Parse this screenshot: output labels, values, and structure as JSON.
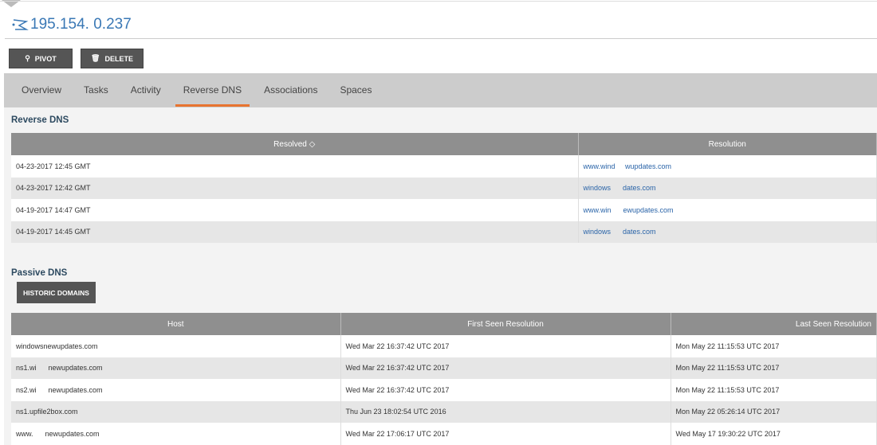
{
  "header": {
    "title": "195.154.  0.237",
    "pivot": "PIVOT",
    "delete": "DELETE"
  },
  "tabs": [
    "Overview",
    "Tasks",
    "Activity",
    "Reverse DNS",
    "Associations",
    "Spaces"
  ],
  "reverse_dns": {
    "title": "Reverse DNS",
    "columns": [
      "Resolved ◇",
      "Resolution"
    ],
    "rows": [
      [
        "04-23-2017 12:45 GMT",
        "www.wind     wupdates.com"
      ],
      [
        "04-23-2017 12:42 GMT",
        "windows      dates.com"
      ],
      [
        "04-19-2017 14:47 GMT",
        "www.win      ewupdates.com"
      ],
      [
        "04-19-2017 14:45 GMT",
        "windows      dates.com"
      ]
    ]
  },
  "passive_dns": {
    "title": "Passive DNS",
    "historic_button": "HISTORIC DOMAINS",
    "columns": [
      "Host",
      "First Seen Resolution",
      "Last Seen Resolution"
    ],
    "rows": [
      [
        "windowsnewupdates.com",
        "Wed Mar 22 16:37:42 UTC 2017",
        "Mon May 22 11:15:53 UTC 2017"
      ],
      [
        "ns1.wi      newupdates.com",
        "Wed Mar 22 16:37:42 UTC 2017",
        "Mon May 22 11:15:53 UTC 2017"
      ],
      [
        "ns2.wi      newupdates.com",
        "Wed Mar 22 16:37:42 UTC 2017",
        "Mon May 22 11:15:53 UTC 2017"
      ],
      [
        "ns1.upfile2box.com",
        "Thu Jun 23 18:02:54 UTC 2016",
        "Mon May 22 05:26:14 UTC 2017"
      ],
      [
        "www.      newupdates.com",
        "Wed Mar 22 17:06:17 UTC 2017",
        "Wed May 17 19:30:22 UTC 2017"
      ]
    ]
  }
}
